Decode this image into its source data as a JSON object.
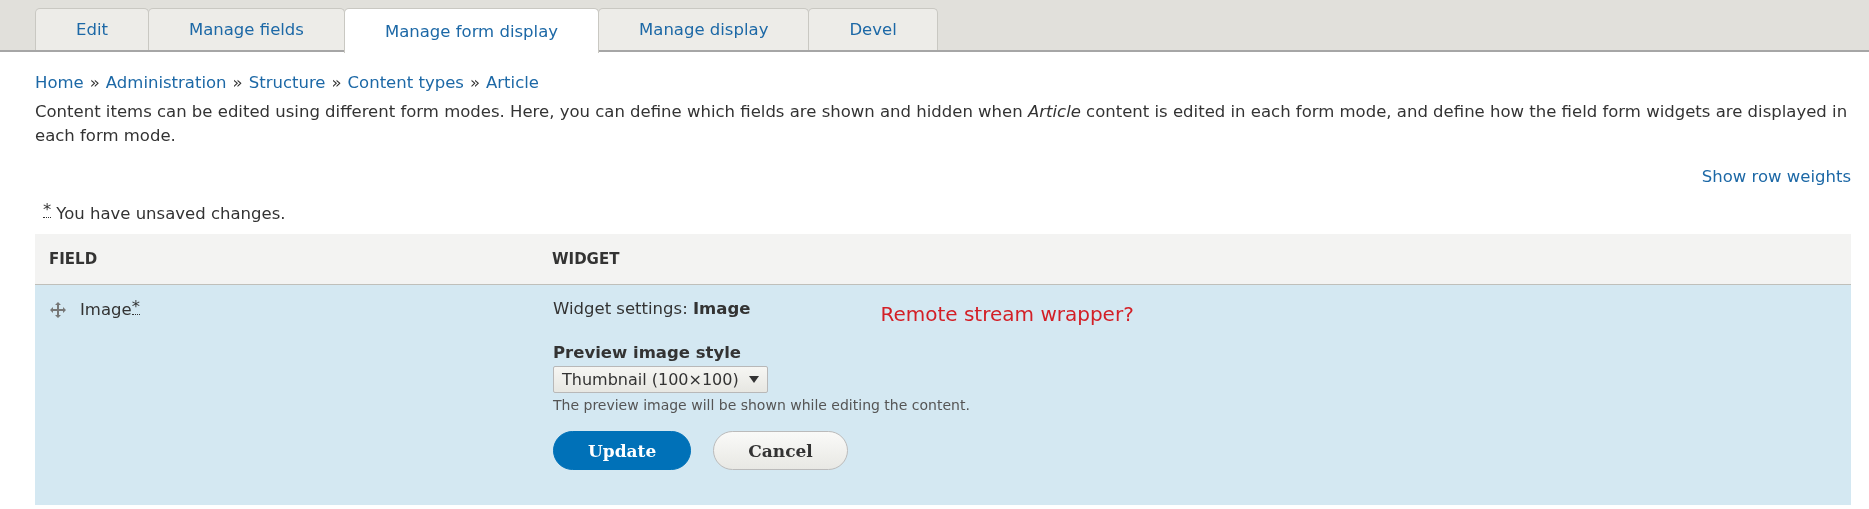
{
  "tabs": [
    {
      "label": "Edit",
      "selected": false
    },
    {
      "label": "Manage fields",
      "selected": false
    },
    {
      "label": "Manage form display",
      "selected": true
    },
    {
      "label": "Manage display",
      "selected": false
    },
    {
      "label": "Devel",
      "selected": false
    }
  ],
  "breadcrumb": {
    "items": [
      "Home",
      "Administration",
      "Structure",
      "Content types",
      "Article"
    ],
    "separators": [
      "»",
      "»",
      "»",
      "»"
    ]
  },
  "description": "Content items can be edited using different form modes. Here, you can define which fields are shown and hidden when *Article* content is edited in each form mode, and define how the field form widgets are displayed in each form mode.",
  "show_row_weights": "Show row weights",
  "unsaved": {
    "marker": "*",
    "message": "You have unsaved changes."
  },
  "table": {
    "columns": [
      "FIELD",
      "WIDGET"
    ],
    "rows": [
      {
        "field": "Image",
        "changed_marker": "*",
        "widget_settings": "Widget settings: **Image**",
        "note": "Remote stream wrapper?",
        "setting_label": "Preview image style",
        "select_value": "Thumbnail (100×100)",
        "help": "The preview image will be shown while editing the content.",
        "buttons": [
          {
            "label": "Update",
            "kind": "primary"
          },
          {
            "label": "Cancel",
            "kind": "secondary"
          }
        ]
      }
    ]
  }
}
